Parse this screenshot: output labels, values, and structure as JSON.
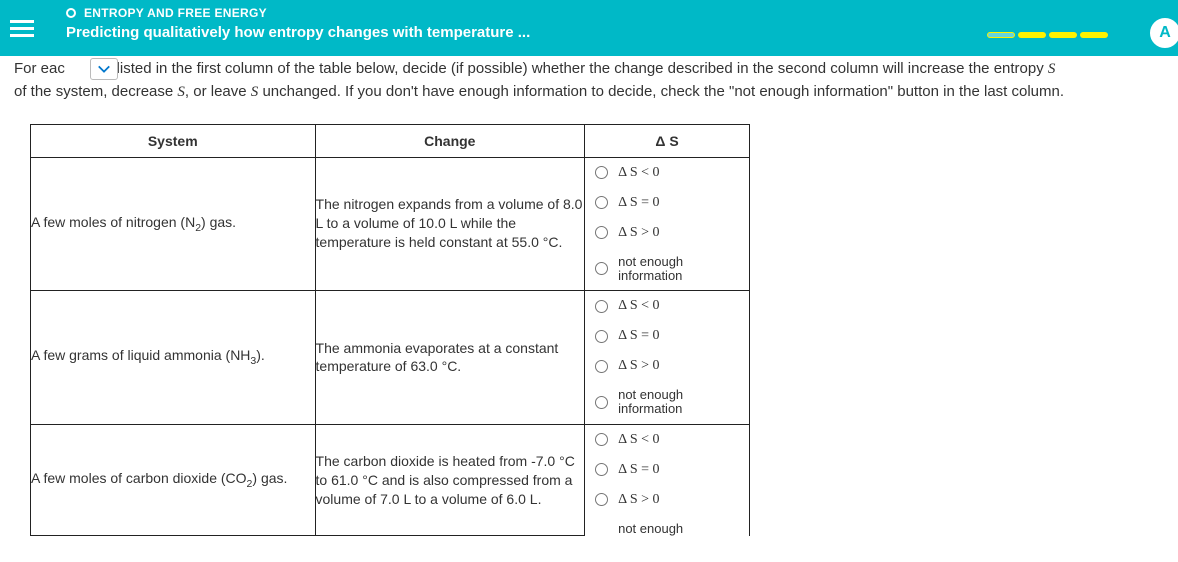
{
  "header": {
    "breadcrumb": "ENTROPY AND FREE ENERGY",
    "title": "Predicting qualitatively how entropy changes with temperature ...",
    "badge": "A"
  },
  "instructions": {
    "line1_a": "For eac",
    "line1_b": "em listed in the first column of the table below, decide (if possible) whether the change described in the second column will increase the entropy ",
    "s1": "S",
    "line2_a": "of the system, decrease ",
    "s2": "S",
    "line2_b": ", or leave ",
    "s3": "S",
    "line2_c": " unchanged. If you don't have enough information to decide, check the \"not enough information\" button in the last column."
  },
  "table": {
    "headers": {
      "system": "System",
      "change": "Change",
      "ds": "Δ S"
    },
    "options": {
      "lt": "Δ S < 0",
      "eq": "Δ S = 0",
      "gt": "Δ S > 0",
      "nei1": "not enough",
      "nei2": "information"
    },
    "rows": [
      {
        "system_a": "A few moles of nitrogen (N",
        "system_sub": "2",
        "system_b": ") gas.",
        "change": "The nitrogen expands from a volume of 8.0 L to a volume of 10.0 L while the temperature is held constant at 55.0 °C."
      },
      {
        "system_a": "A few grams of liquid ammonia (NH",
        "system_sub": "3",
        "system_b": ").",
        "change": "The ammonia evaporates at a constant temperature of 63.0 °C."
      },
      {
        "system_a": "A few moles of carbon dioxide (CO",
        "system_sub": "2",
        "system_b": ") gas.",
        "change": "The carbon dioxide is heated from -7.0 °C to 61.0 °C and is also compressed from a volume of 7.0 L to a volume of 6.0 L."
      }
    ]
  }
}
